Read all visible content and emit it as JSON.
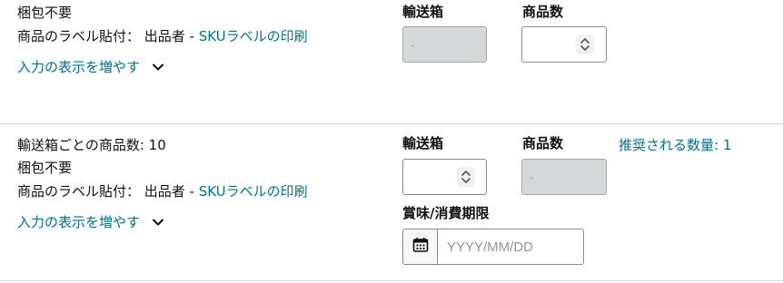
{
  "items": [
    {
      "details": [
        "梱包不要"
      ],
      "label_prefix": "商品のラベル貼付： 出品者 - ",
      "label_link": "SKUラベルの印刷",
      "show_more": "入力の表示を増やす",
      "box_label": "輸送箱",
      "box_value": "-",
      "qty_label": "商品数",
      "qty_value": ""
    },
    {
      "details": [
        "輸送箱ごとの商品数: 10",
        "梱包不要"
      ],
      "label_prefix": "商品のラベル貼付： 出品者 - ",
      "label_link": "SKUラベルの印刷",
      "show_more": "入力の表示を増やす",
      "box_label": "輸送箱",
      "box_value": "",
      "qty_label": "商品数",
      "qty_value": "-",
      "recommended": "推奨される数量: 1",
      "expiry_label": "賞味/消費期限",
      "expiry_placeholder": "YYYY/MM/DD"
    }
  ],
  "colors": {
    "link": "#007185",
    "text": "#0f1111",
    "disabled_bg": "#d5d9d9",
    "divider": "#d5d9d9"
  },
  "icons": [
    "stepper-icon",
    "chevron-down-icon",
    "calendar-icon"
  ]
}
